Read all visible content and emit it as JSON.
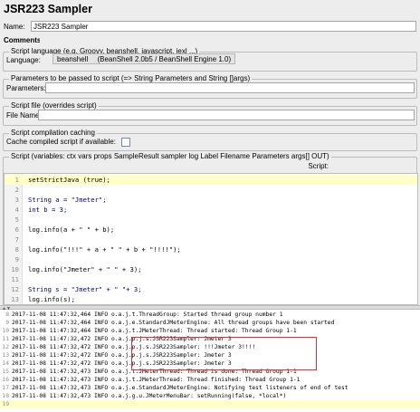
{
  "title": "JSR223 Sampler",
  "name_label": "Name:",
  "name_value": "JSR223 Sampler",
  "comments_label": "Comments:",
  "language_section": {
    "legend": "Script language (e.g. Groovy, beanshell, javascript, jexl ...)",
    "label": "Language:",
    "value": "beanshell",
    "engine": "(BeanShell 2.0b5 / BeanShell Engine 1.0)"
  },
  "params_section": {
    "legend": "Parameters to be passed to script (=> String Parameters and String []args)",
    "label": "Parameters:"
  },
  "file_section": {
    "legend": "Script file (overrides script)",
    "label": "File Name:"
  },
  "caching_section": {
    "legend": "Script compilation caching",
    "label": "Cache compiled script if available:"
  },
  "script_section": {
    "legend": "Script (variables: ctx vars props SampleResult sampler log Label Filename Parameters args[] OUT)",
    "header": "Script:",
    "lines": [
      {
        "n": "1",
        "text": "setStrictJava (true);"
      },
      {
        "n": "2",
        "text": ""
      },
      {
        "n": "3",
        "text": "String a = \"Jmeter\";"
      },
      {
        "n": "4",
        "text": "int b = 3;"
      },
      {
        "n": "5",
        "text": ""
      },
      {
        "n": "6",
        "text": "log.info(a + \" \" + b);"
      },
      {
        "n": "7",
        "text": ""
      },
      {
        "n": "8",
        "text": "log.info(\"!!!\" + a + \" \" + b + \"!!!!\");"
      },
      {
        "n": "9",
        "text": ""
      },
      {
        "n": "10",
        "text": "log.info(\"Jmeter\" + \" \" + 3);"
      },
      {
        "n": "11",
        "text": ""
      },
      {
        "n": "12",
        "text": "String s = \"Jmeter\" + \" \"+ 3;"
      },
      {
        "n": "13",
        "text": "log.info(s);"
      },
      {
        "n": "14",
        "text": ""
      }
    ]
  },
  "log_lines": [
    {
      "n": "8",
      "text": "2017-11-08 11:47:32,464 INFO o.a.j.t.ThreadGroup: Started thread group number 1"
    },
    {
      "n": "9",
      "text": "2017-11-08 11:47:32,464 INFO o.a.j.e.StandardJMeterEngine: All thread groups have been started"
    },
    {
      "n": "10",
      "text": "2017-11-08 11:47:32,464 INFO o.a.j.t.JMeterThread: Thread started: Thread Group 1-1"
    },
    {
      "n": "11",
      "text": "2017-11-08 11:47:32,472 INFO o.a.j.p.j.s.JSR223Sampler: Jmeter 3"
    },
    {
      "n": "12",
      "text": "2017-11-08 11:47:32,472 INFO o.a.j.p.j.s.JSR223Sampler: !!!Jmeter 3!!!!"
    },
    {
      "n": "13",
      "text": "2017-11-08 11:47:32,472 INFO o.a.j.p.j.s.JSR223Sampler: Jmeter 3"
    },
    {
      "n": "14",
      "text": "2017-11-08 11:47:32,472 INFO o.a.j.p.j.s.JSR223Sampler: Jmeter 3"
    },
    {
      "n": "15",
      "text": "2017-11-08 11:47:32,473 INFO o.a.j.t.JMeterThread: Thread is done: Thread Group 1-1"
    },
    {
      "n": "16",
      "text": "2017-11-08 11:47:32,473 INFO o.a.j.t.JMeterThread: Thread finished: Thread Group 1-1"
    },
    {
      "n": "17",
      "text": "2017-11-08 11:47:32,473 INFO o.a.j.e.StandardJMeterEngine: Notifying test listeners of end of test"
    },
    {
      "n": "18",
      "text": "2017-11-08 11:47:32,473 INFO o.a.j.g.u.JMeterMenuBar: setRunning(false, *local*)"
    },
    {
      "n": "19",
      "text": ""
    }
  ],
  "colors": {
    "highlight_box": "#e3303a",
    "current_line": "#ffffc8"
  }
}
